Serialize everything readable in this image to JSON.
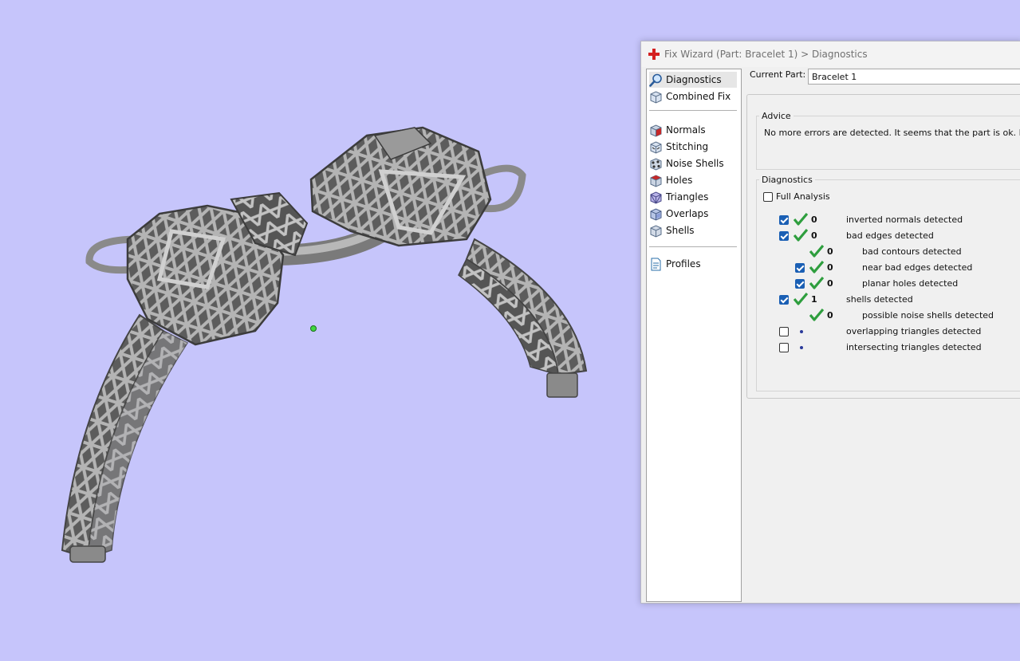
{
  "window": {
    "title": "Fix Wizard (Part: Bracelet 1) > Diagnostics"
  },
  "sidebar": {
    "items": [
      {
        "label": "Diagnostics",
        "icon": "magnifier-icon",
        "selected": true
      },
      {
        "label": "Combined Fix",
        "icon": "cube-icon"
      },
      {
        "label": "Normals",
        "icon": "normals-cube-icon"
      },
      {
        "label": "Stitching",
        "icon": "stitching-cube-icon"
      },
      {
        "label": "Noise Shells",
        "icon": "noise-shells-icon"
      },
      {
        "label": "Holes",
        "icon": "holes-cube-icon"
      },
      {
        "label": "Triangles",
        "icon": "triangles-cube-icon"
      },
      {
        "label": "Overlaps",
        "icon": "overlaps-cube-icon"
      },
      {
        "label": "Shells",
        "icon": "shells-cube-icon"
      },
      {
        "label": "Profiles",
        "icon": "profile-document-icon"
      }
    ]
  },
  "current_part": {
    "label": "Current Part:",
    "value": "Bracelet 1"
  },
  "advice": {
    "title": "Advice",
    "text": "No more errors are detected. It seems that the part is ok. Note tha"
  },
  "diagnostics": {
    "title": "Diagnostics",
    "full_analysis_label": "Full Analysis",
    "full_analysis_checked": false,
    "rows": [
      {
        "checked": true,
        "status": "ok",
        "count": "0",
        "label": "inverted normals detected",
        "indent": 0
      },
      {
        "checked": true,
        "status": "ok",
        "count": "0",
        "label": "bad edges detected",
        "indent": 0
      },
      {
        "checked": null,
        "status": "ok",
        "count": "0",
        "label": "bad contours detected",
        "indent": 1
      },
      {
        "checked": true,
        "status": "ok",
        "count": "0",
        "label": "near bad edges detected",
        "indent": 1
      },
      {
        "checked": true,
        "status": "ok",
        "count": "0",
        "label": "planar holes detected",
        "indent": 1
      },
      {
        "checked": true,
        "status": "ok",
        "count": "1",
        "label": "shells detected",
        "indent": 0
      },
      {
        "checked": null,
        "status": "ok",
        "count": "0",
        "label": "possible noise shells detected",
        "indent": 1
      },
      {
        "checked": false,
        "status": "none",
        "count": "",
        "label": "overlapping triangles detected",
        "indent": 0
      },
      {
        "checked": false,
        "status": "none",
        "count": "",
        "label": "intersecting triangles detected",
        "indent": 0
      }
    ]
  },
  "colors": {
    "viewport_bg": "#c6c5fb",
    "check_green": "#2e9e3e",
    "checkbox_blue": "#1a5fb4",
    "model_gray": "#8e8e8e"
  }
}
